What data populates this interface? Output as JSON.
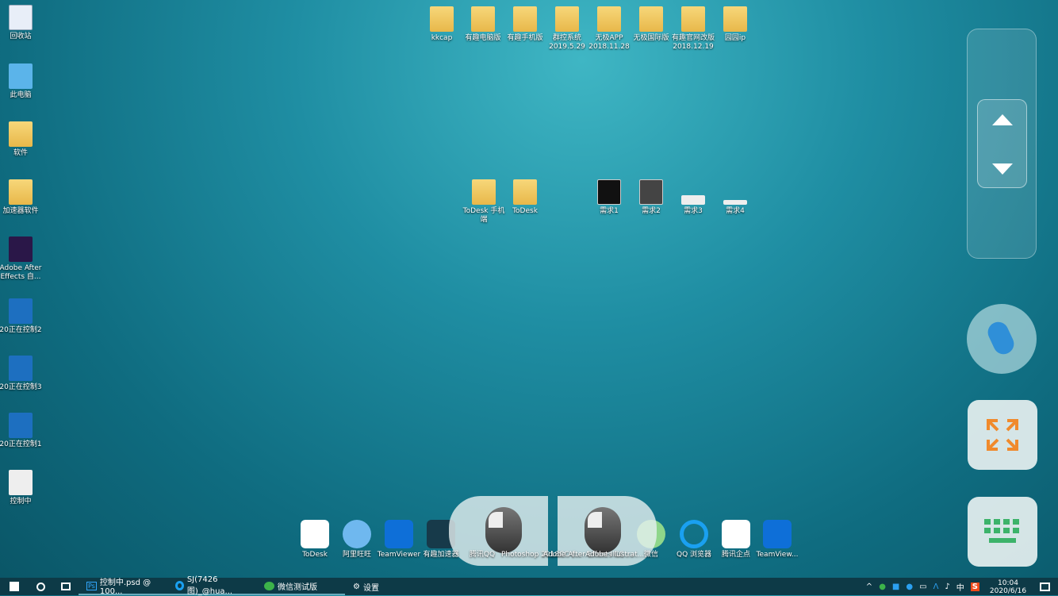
{
  "desktop_left": [
    "回收站",
    "此电脑",
    "软件",
    "加速器软件",
    "Adobe After Effects 自...",
    "20正在控制2",
    "20正在控制3",
    "20正在控制1",
    "控制中"
  ],
  "desktop_top": [
    "kkcap",
    "有趣电脑版",
    "有趣手机版",
    "群控系统 2019.5.29",
    "无极APP 2018.11.28",
    "无极国际版",
    "有趣官网改版 2018.12.19",
    "园园ip"
  ],
  "desktop_mid": [
    "ToDesk 手机端",
    "ToDesk",
    "需求1",
    "需求2",
    "需求3",
    "需求4"
  ],
  "dock": [
    "ToDesk",
    "阿里旺旺",
    "TeamViewer",
    "有趣加速器",
    "腾讯QQ",
    "Photoshop 2018CC (...",
    "Adobe After Effects CC ...",
    "Adobe Illustrat...",
    "微信",
    "QQ 浏览器",
    "腾讯企点",
    "TeamView..."
  ],
  "taskbar": {
    "items": [
      "控制中.psd @ 100...",
      "SJ(7426图)_@hua...",
      "微信测试版",
      "设置"
    ],
    "time": "10:04",
    "date": "2020/6/16",
    "ime": "中"
  },
  "colors": {
    "accent_orange": "#f08a2c",
    "keyboard_green": "#3cb36a",
    "mouse_blue": "#2f8fd8"
  }
}
